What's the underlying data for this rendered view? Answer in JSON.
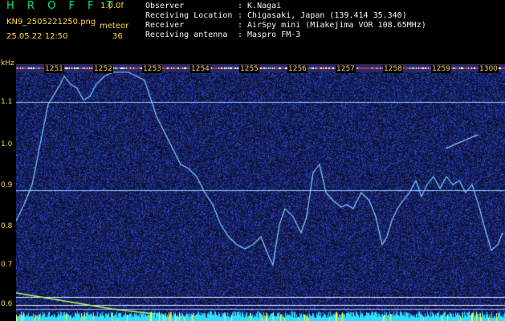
{
  "header": {
    "logo": "H R O F F T",
    "version": "1.0.0f",
    "filename": "KN9_2505221250.png",
    "meteor_label": "meteor",
    "datetime": "25.05.22 12:50",
    "meteor_count": "36",
    "info": [
      {
        "key": "Observer",
        "value": ": K.Nagai"
      },
      {
        "key": "Receiving Location",
        "value": ": Chigasaki, Japan (139.414 35.340)"
      },
      {
        "key": "Receiver",
        "value": ": AirSpy mini (Miakejima VOR 108.65MHz)"
      },
      {
        "key": "Receiving antenna",
        "value": ": Maspro FM-3"
      }
    ]
  },
  "axis": {
    "unit": "kHz",
    "y_labels": [
      "1.1",
      "1.0",
      "0.9",
      "0.8",
      "0.7",
      "0.6"
    ],
    "x_labels": [
      "1251",
      "1252",
      "1253",
      "1254",
      "1255",
      "1256",
      "1257",
      "1258",
      "1259",
      "1300"
    ]
  },
  "colors": {
    "background": "#000000",
    "noise": "#1b2a8a",
    "trace": "#7fd0ff",
    "labels": "#ffd54a",
    "header_text": "#f4f4f4",
    "logo": "#00e676"
  }
}
